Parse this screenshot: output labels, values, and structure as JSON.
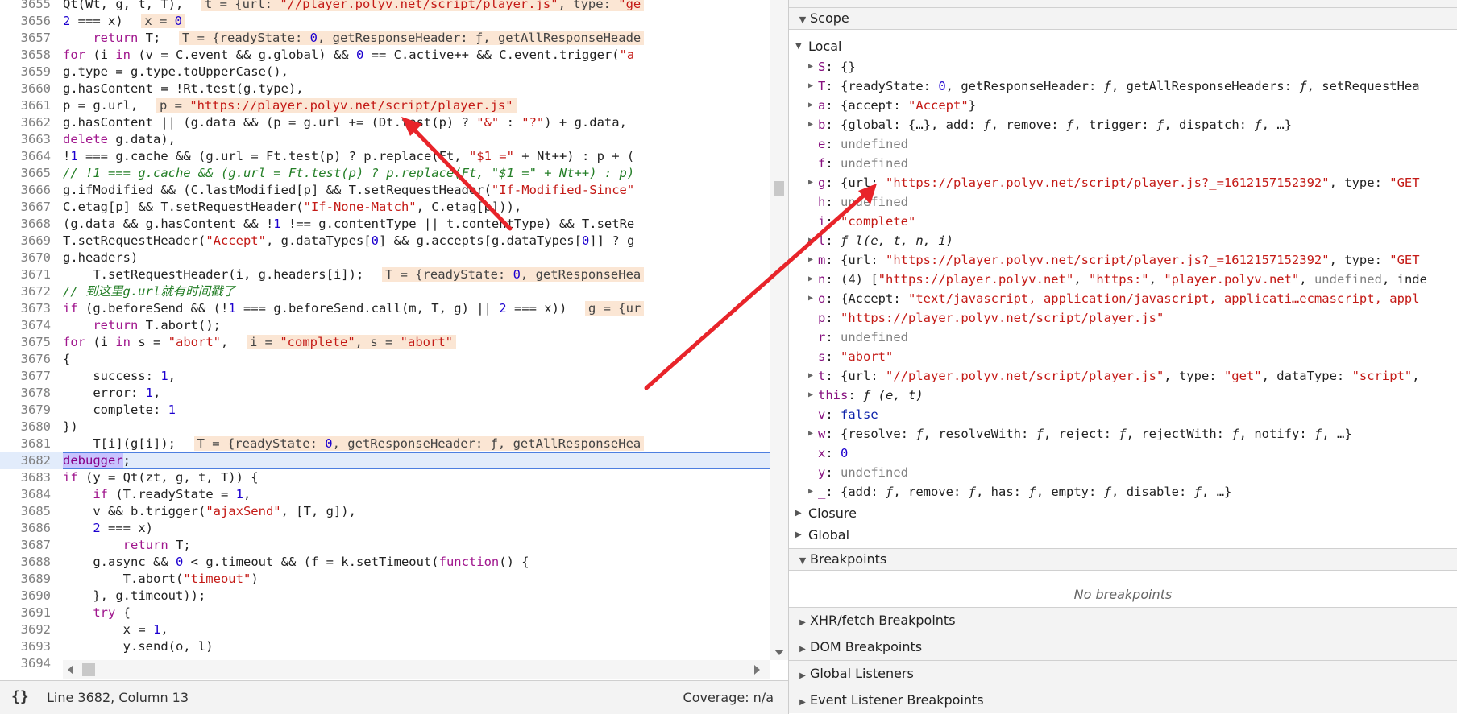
{
  "editor": {
    "lines": [
      {
        "n": "3655"
      },
      {
        "n": "3656"
      },
      {
        "n": "3657"
      },
      {
        "n": "3658"
      },
      {
        "n": "3659"
      },
      {
        "n": "3660"
      },
      {
        "n": "3661"
      },
      {
        "n": "3662"
      },
      {
        "n": "3663"
      },
      {
        "n": "3664"
      },
      {
        "n": "3665"
      },
      {
        "n": "3666"
      },
      {
        "n": "3667"
      },
      {
        "n": "3668"
      },
      {
        "n": "3669"
      },
      {
        "n": "3670"
      },
      {
        "n": "3671"
      },
      {
        "n": "3672"
      },
      {
        "n": "3673"
      },
      {
        "n": "3674"
      },
      {
        "n": "3675"
      },
      {
        "n": "3676"
      },
      {
        "n": "3677"
      },
      {
        "n": "3678"
      },
      {
        "n": "3679"
      },
      {
        "n": "3680"
      },
      {
        "n": "3681"
      },
      {
        "n": "3682"
      },
      {
        "n": "3683"
      },
      {
        "n": "3684"
      },
      {
        "n": "3685"
      },
      {
        "n": "3686"
      },
      {
        "n": "3687"
      },
      {
        "n": "3688"
      },
      {
        "n": "3689"
      },
      {
        "n": "3690"
      },
      {
        "n": "3691"
      },
      {
        "n": "3692"
      },
      {
        "n": "3693"
      },
      {
        "n": "3694"
      }
    ],
    "current_line": "3682"
  },
  "status": {
    "format_button": "{}",
    "position": "Line 3682, Column 13",
    "coverage": "Coverage: n/a"
  },
  "sidebar": {
    "scope_title": "Scope",
    "local_title": "Local",
    "closure_title": "Closure",
    "global_title": "Global",
    "breakpoints_title": "Breakpoints",
    "no_breakpoints": "No breakpoints",
    "xhr_title": "XHR/fetch Breakpoints",
    "dom_title": "DOM Breakpoints",
    "global_listeners_title": "Global Listeners",
    "event_listener_title": "Event Listener Breakpoints"
  },
  "colors": {
    "keyword": "#a0168d",
    "string": "#c41a16",
    "number": "#1c00cf",
    "comment": "#237e26",
    "inline_value_bg": "#fbe6d4",
    "exec_line_bg": "#e2ecfb",
    "arrow": "#e8242a"
  }
}
